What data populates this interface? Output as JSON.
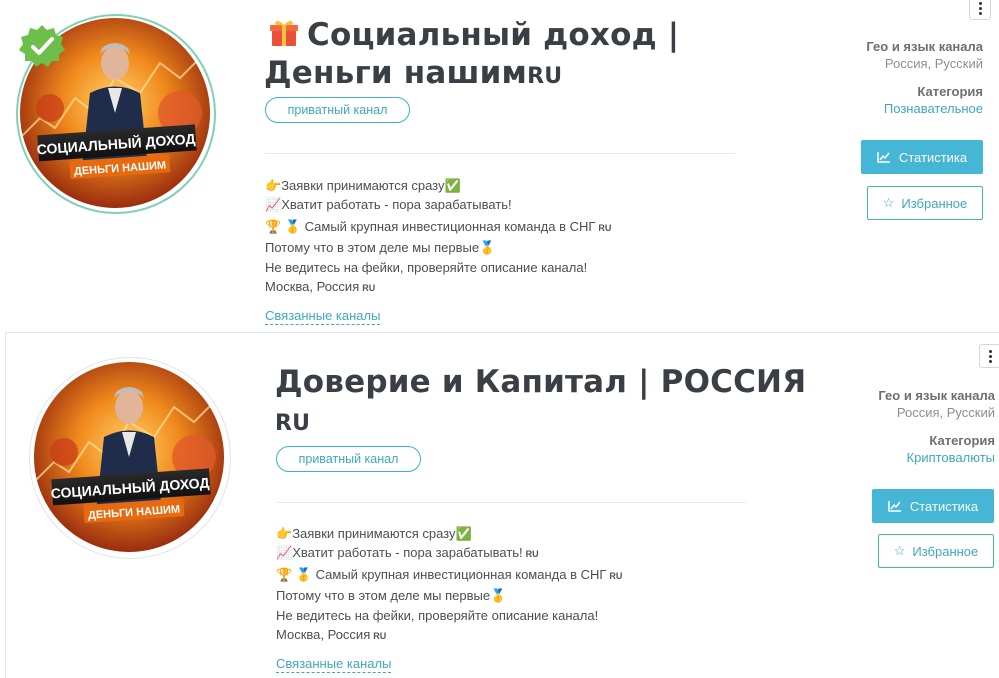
{
  "colors": {
    "accent": "#45b6d6",
    "badge": "#3fb0c9",
    "verified": "#6cc04a"
  },
  "cards": [
    {
      "title_line1": "Социальный доход |",
      "title_line2": "Деньги нашим",
      "title_flag": "RU",
      "title_icon": "gift-icon",
      "verified": true,
      "badge": "приватный канал",
      "avatar_line1": "СОЦИАЛЬНЫЙ ДОХОД",
      "avatar_line2": "ДЕНЬГИ НАШИМ",
      "desc": [
        "Заявки принимаются сразу",
        "Хватит работать - пора зарабатывать!",
        "Самый крупная инвестиционная команда в СНГ",
        "Потому что в этом деле мы первые",
        "Не ведитесь на фейки, проверяйте описание канала!",
        "Москва, Россия"
      ],
      "desc_flags": {
        "line2": "",
        "line3": "RU",
        "line6": "RU"
      },
      "related": "Связанные каналы",
      "geo_label": "Гео и язык канала",
      "geo_value": "Россия, Русский",
      "category_label": "Категория",
      "category_value": "Познавательное",
      "stats_button": "Статистика",
      "fav_button": "Избранное"
    },
    {
      "title_line1": "Доверие и Капитал | РОССИЯ",
      "title_line2": "",
      "title_flag": "RU",
      "verified": false,
      "badge": "приватный канал",
      "avatar_line1": "СОЦИАЛЬНЫЙ ДОХОД",
      "avatar_line2": "ДЕНЬГИ НАШИМ",
      "desc": [
        "Заявки принимаются сразу",
        "Хватит работать - пора зарабатывать!",
        "Самый крупная инвестиционная команда в СНГ",
        "Потому что в этом деле мы первые",
        "Не ведитесь на фейки, проверяйте описание канала!",
        "Москва, Россия"
      ],
      "desc_flags": {
        "line2": "RU",
        "line3": "RU",
        "line6": "RU"
      },
      "related": "Связанные каналы",
      "geo_label": "Гео и язык канала",
      "geo_value": "Россия, Русский",
      "category_label": "Категория",
      "category_value": "Криптовалюты",
      "stats_button": "Статистика",
      "fav_button": "Избранное"
    }
  ]
}
